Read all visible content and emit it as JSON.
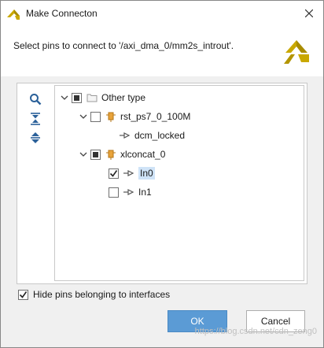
{
  "window": {
    "title": "Make Connecton"
  },
  "header": {
    "instruction": "Select pins to connect to '/axi_dma_0/mm2s_introut'."
  },
  "tree": {
    "root": {
      "label": "Other type"
    },
    "rst": {
      "label": "rst_ps7_0_100M",
      "children": [
        {
          "label": "dcm_locked"
        }
      ]
    },
    "concat": {
      "label": "xlconcat_0",
      "children": [
        {
          "label": "In0",
          "checked": true
        },
        {
          "label": "In1",
          "checked": false
        }
      ]
    }
  },
  "footer": {
    "hide_pins_label": "Hide pins belonging to interfaces",
    "hide_pins_checked": true
  },
  "buttons": {
    "ok": "OK",
    "cancel": "Cancel"
  },
  "watermark": "https://blog.csdn.net/cdn_zeng0",
  "colors": {
    "brand": "#c9a800",
    "ok_button": "#5b9bd5",
    "selection": "#cfe3f7"
  },
  "icons": [
    "xilinx-logo-icon",
    "close-icon",
    "search-icon",
    "collapse-all-icon",
    "expand-all-icon",
    "folder-icon",
    "block-icon",
    "pin-icon",
    "chevron-down-icon",
    "checkmark-icon"
  ]
}
